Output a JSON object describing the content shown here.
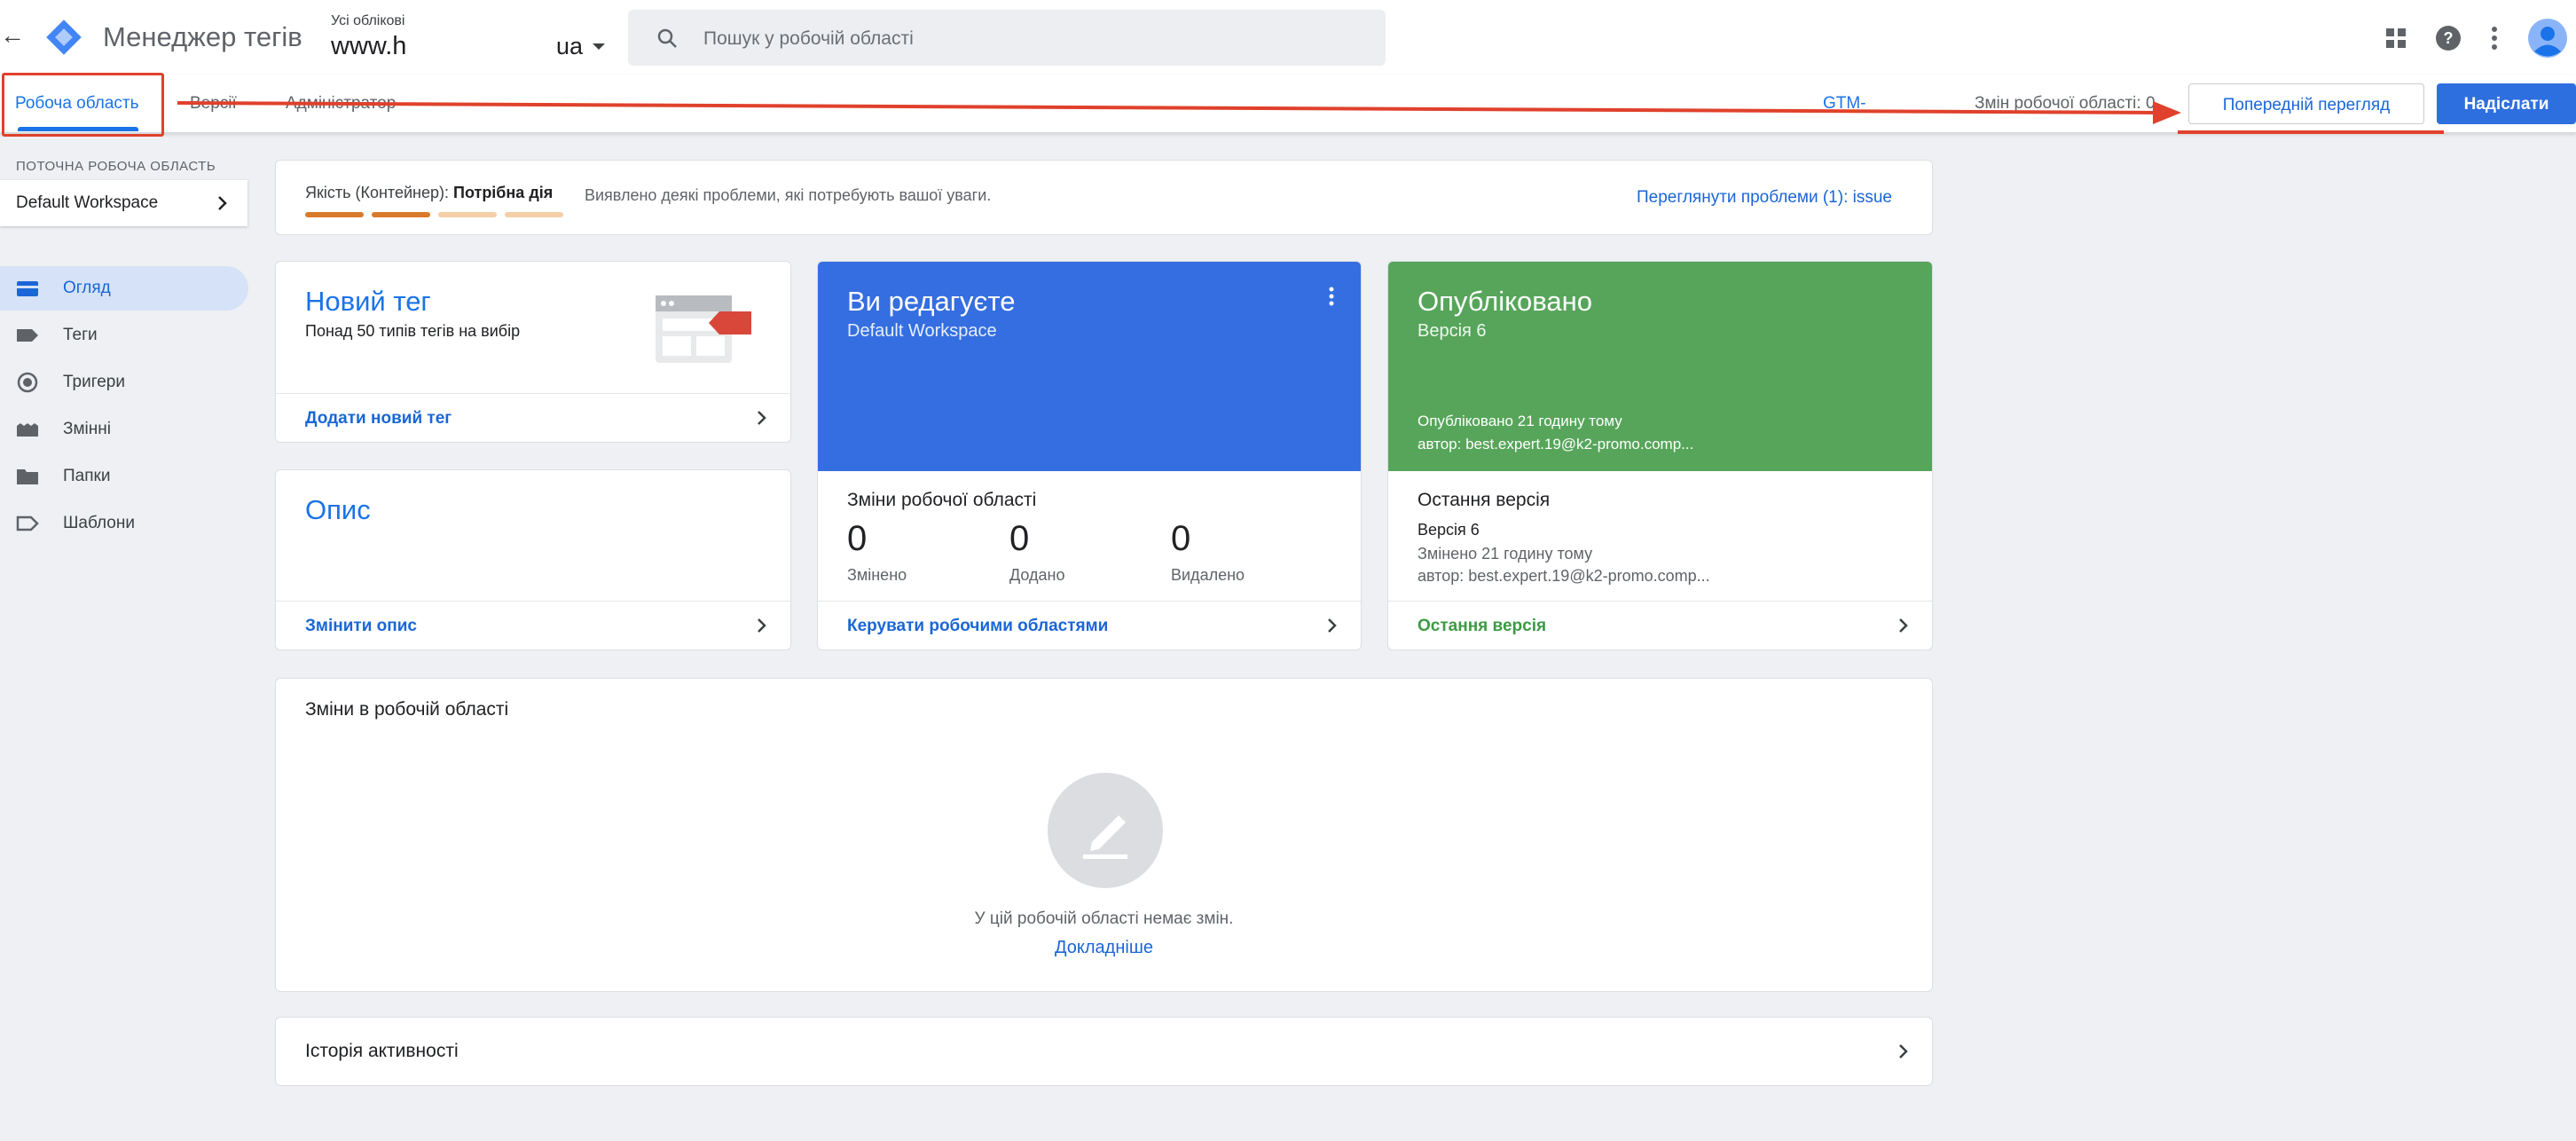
{
  "header": {
    "back_glyph": "←",
    "app_name": "Менеджер тегів",
    "account_caption": "Усі облікові",
    "container_name": "www.h",
    "container_suffix": "ua",
    "search_placeholder": "Пошук у робочій області"
  },
  "tabs": {
    "workspace": "Робоча область",
    "versions": "Версії",
    "admin": "Адміністратор"
  },
  "toolbar": {
    "gtm_id": "GTM-",
    "workspace_changes": "Змін робочої області: 0",
    "preview_label": "Попередній перегляд",
    "submit_label": "Надіслати"
  },
  "sidebar": {
    "current_workspace_caption": "ПОТОЧНА РОБОЧА ОБЛАСТЬ",
    "workspace_name": "Default Workspace",
    "items": [
      {
        "label": "Огляд",
        "icon": "overview-icon",
        "active": true
      },
      {
        "label": "Теги",
        "icon": "tag-icon",
        "active": false
      },
      {
        "label": "Тригери",
        "icon": "trigger-icon",
        "active": false
      },
      {
        "label": "Змінні",
        "icon": "variables-icon",
        "active": false
      },
      {
        "label": "Папки",
        "icon": "folder-icon",
        "active": false
      },
      {
        "label": "Шаблони",
        "icon": "template-icon",
        "active": false
      }
    ]
  },
  "quality": {
    "label": "Якість (Контейнер):",
    "status": "Потрібна дія",
    "message": "Виявлено деякі проблеми, які потребують вашої уваги.",
    "link": "Переглянути проблеми (1): issue",
    "segments": [
      1,
      1,
      0,
      0
    ]
  },
  "new_tag": {
    "title": "Новий тег",
    "subtitle": "Понад 50 типів тегів на вибір",
    "link": "Додати новий тег"
  },
  "description": {
    "title": "Опис",
    "link": "Змінити опис"
  },
  "editing": {
    "title": "Ви редагуєте",
    "workspace": "Default Workspace",
    "changes_title": "Зміни робочої області",
    "stats": [
      {
        "value": "0",
        "label": "Змінено"
      },
      {
        "value": "0",
        "label": "Додано"
      },
      {
        "value": "0",
        "label": "Видалено"
      }
    ],
    "link": "Керувати робочими областями"
  },
  "published": {
    "title": "Опубліковано",
    "version": "Версія 6",
    "published_when": "Опубліковано 21 годину тому",
    "author": "автор: best.expert.19@k2-promo.comp...",
    "latest_title": "Остання версія",
    "latest_version": "Версія 6",
    "changed_when": "Змінено 21 годину тому",
    "latest_author": "автор: best.expert.19@k2-promo.comp...",
    "link": "Остання версія"
  },
  "workspace_changes": {
    "title": "Зміни в робочій області",
    "empty_text": "У цій робочій області немає змін.",
    "link": "Докладніше"
  },
  "activity": {
    "title": "Історія активності"
  },
  "colors": {
    "accent": "#1a73e8",
    "editing_blue": "#356ee0",
    "published_green": "#57a55b",
    "annotation_red": "#e0412c",
    "quality_orange": "#d97a2b",
    "quality_light": "#f5cfa8"
  }
}
